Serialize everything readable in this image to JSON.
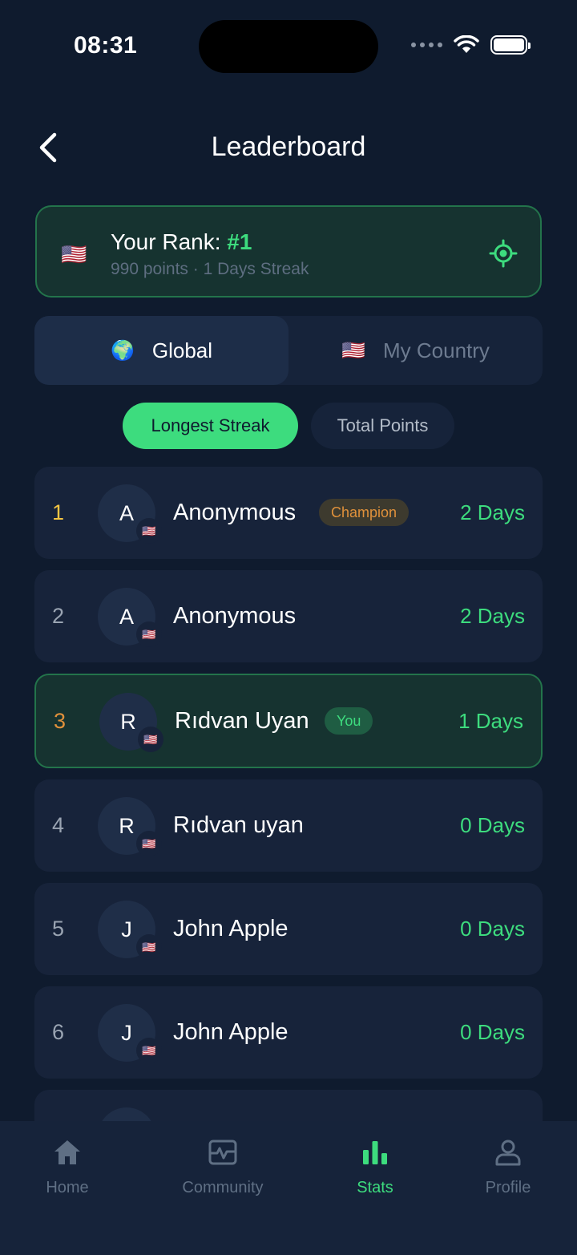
{
  "status_bar": {
    "time": "08:31"
  },
  "header": {
    "title": "Leaderboard"
  },
  "rank_card": {
    "flag": "🇺🇸",
    "label": "Your Rank: ",
    "rank": "#1",
    "subtitle": "990 points · 1 Days Streak"
  },
  "scope_tabs": [
    {
      "emoji": "🌍",
      "label": "Global",
      "active": true
    },
    {
      "emoji": "🇺🇸",
      "label": "My Country",
      "active": false
    }
  ],
  "metric_pills": [
    {
      "label": "Longest Streak",
      "active": true
    },
    {
      "label": "Total Points",
      "active": false
    }
  ],
  "leaderboard": [
    {
      "rank": "1",
      "initial": "A",
      "flag": "🇺🇸",
      "name": "Anonymous",
      "badge": "Champion",
      "streak": "2 Days"
    },
    {
      "rank": "2",
      "initial": "A",
      "flag": "🇺🇸",
      "name": "Anonymous",
      "badge": "",
      "streak": "2 Days"
    },
    {
      "rank": "3",
      "initial": "R",
      "flag": "🇺🇸",
      "name": "Rıdvan Uyan",
      "badge": "You",
      "streak": "1 Days"
    },
    {
      "rank": "4",
      "initial": "R",
      "flag": "🇺🇸",
      "name": "Rıdvan uyan",
      "badge": "",
      "streak": "0 Days"
    },
    {
      "rank": "5",
      "initial": "J",
      "flag": "🇺🇸",
      "name": "John Apple",
      "badge": "",
      "streak": "0 Days"
    },
    {
      "rank": "6",
      "initial": "J",
      "flag": "🇺🇸",
      "name": "John Apple",
      "badge": "",
      "streak": "0 Days"
    }
  ],
  "tab_bar": [
    {
      "label": "Home",
      "icon": "home-icon",
      "active": false
    },
    {
      "label": "Community",
      "icon": "activity-icon",
      "active": false
    },
    {
      "label": "Stats",
      "icon": "bar-chart-icon",
      "active": true
    },
    {
      "label": "Profile",
      "icon": "person-icon",
      "active": false
    }
  ],
  "colors": {
    "accent": "#3ddc7e",
    "background": "#0f1b2e",
    "card": "#17233a",
    "gold": "#f5c542",
    "bronze": "#e0913b"
  }
}
